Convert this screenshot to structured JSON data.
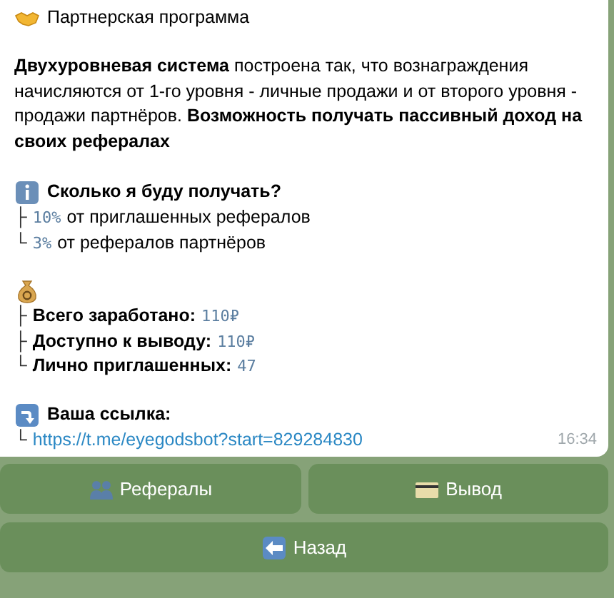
{
  "message": {
    "title": "Партнерская программа",
    "intro": "**Двухуровневая система** построена так, что вознаграждения начисляются от 1-го уровня - личные продажи и от второго уровня - продажи партнёров. **Возможность получать пассивный доход на своих рефералах**",
    "sections": [
      {
        "kind": "info",
        "heading": "Сколько я буду получать?",
        "items": [
          {
            "branch": "├",
            "parts": [
              {
                "kind": "code",
                "text": "10%"
              },
              {
                "kind": "text",
                "text": "от приглашенных рефералов"
              }
            ]
          },
          {
            "branch": "└",
            "parts": [
              {
                "kind": "code",
                "text": "3%"
              },
              {
                "kind": "text",
                "text": "от рефералов партнёров"
              }
            ]
          }
        ]
      },
      {
        "kind": "money",
        "items": [
          {
            "branch": "├",
            "parts": [
              {
                "kind": "label",
                "text": "Всего заработано:"
              },
              {
                "kind": "code",
                "text": "110₽"
              }
            ]
          },
          {
            "branch": "├",
            "parts": [
              {
                "kind": "label",
                "text": "Доступно к выводу:"
              },
              {
                "kind": "code",
                "text": "110₽"
              }
            ]
          },
          {
            "branch": "└",
            "parts": [
              {
                "kind": "label",
                "text": "Лично приглашенных:"
              },
              {
                "kind": "code",
                "text": "47"
              }
            ]
          }
        ]
      },
      {
        "kind": "link",
        "heading": "Ваша ссылка:",
        "items": [
          {
            "branch": "└",
            "parts": [
              {
                "kind": "link",
                "text": "https://t.me/eyegodsbot?start=829284830"
              }
            ]
          }
        ]
      }
    ],
    "time": "16:34"
  },
  "keyboard": [
    [
      {
        "kind": "people",
        "label": "Рефералы"
      },
      {
        "kind": "card",
        "label": "Вывод"
      }
    ],
    [
      {
        "kind": "back",
        "label": "Назад"
      }
    ]
  ]
}
